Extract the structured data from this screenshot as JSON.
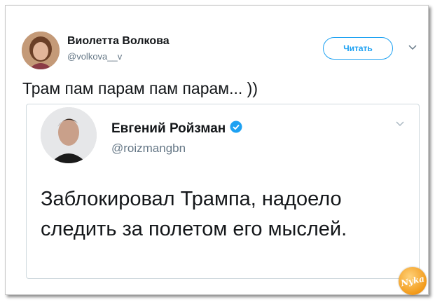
{
  "tweet": {
    "author": {
      "name": "Виолетта Волкова",
      "handle": "@volkova__v"
    },
    "follow_label": "Читать",
    "text": "Трам пам парам пам парам... ))",
    "quoted": {
      "author": {
        "name": "Евгений Ройзман",
        "handle": "@roizmangbn",
        "verified": true
      },
      "text": "Заблокировал Трампа, надоело следить за полетом его мыслей."
    }
  },
  "watermark": {
    "text": "Nyka"
  },
  "icons": {
    "menu": "chevron-down-icon",
    "verified": "verified-badge-icon"
  },
  "colors": {
    "accent": "#1da1f2",
    "text": "#14171a",
    "muted": "#657786",
    "border": "#cfd9de",
    "watermark": "#f29a1a"
  }
}
